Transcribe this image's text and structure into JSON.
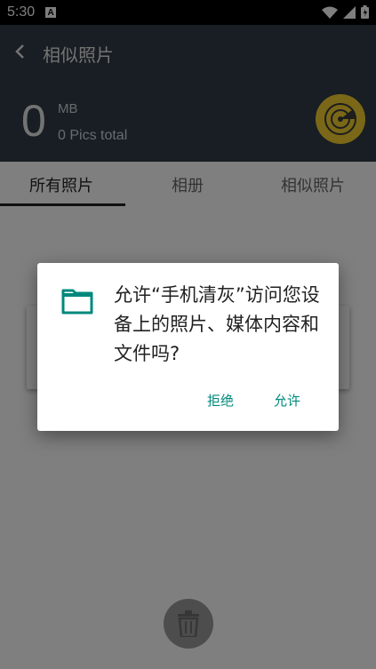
{
  "status_bar": {
    "time": "5:30",
    "notification_icon": "A"
  },
  "header": {
    "title": "相似照片",
    "size_value": "0",
    "size_unit": "MB",
    "pics_total": "0 Pics total"
  },
  "tabs": [
    {
      "label": "所有照片",
      "selected": true
    },
    {
      "label": "相册",
      "selected": false
    },
    {
      "label": "相似照片",
      "selected": false
    }
  ],
  "dialog": {
    "message": "允许“手机清灰”访问您设备上的照片、媒体内容和文件吗?",
    "deny_label": "拒绝",
    "allow_label": "允许"
  },
  "colors": {
    "header_bg": "#303d47",
    "accent_teal": "#00897b",
    "radar_yellow": "#f4d030"
  },
  "icons": {
    "back": "back-arrow-icon",
    "radar": "radar-icon",
    "folder": "folder-icon",
    "trash": "trash-icon",
    "wifi": "wifi-icon",
    "signal": "signal-icon",
    "battery": "battery-icon"
  }
}
